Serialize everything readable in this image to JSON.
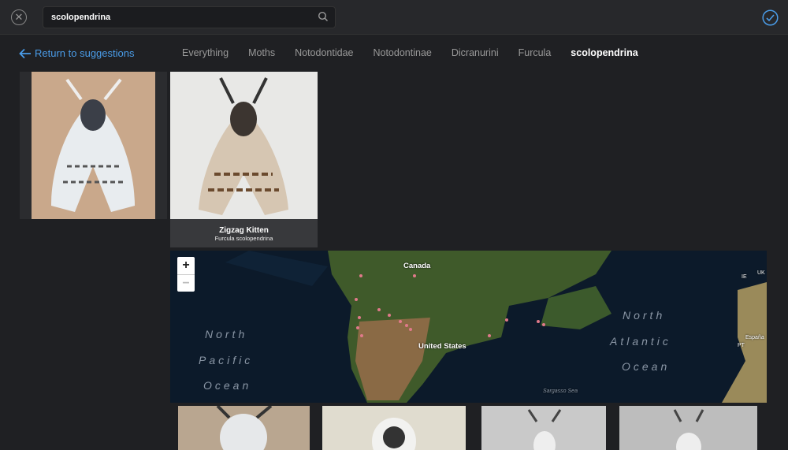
{
  "search": {
    "value": "scolopendrina",
    "icon": "search-icon"
  },
  "nav": {
    "back_label": "Return to suggestions",
    "breadcrumbs": [
      "Everything",
      "Moths",
      "Notodontidae",
      "Notodontinae",
      "Dicranurini",
      "Furcula",
      "scolopendrina"
    ]
  },
  "card": {
    "common_name": "Zigzag Kitten",
    "scientific_name": "Furcula scolopendrina"
  },
  "map": {
    "zoom_in": "+",
    "zoom_out": "−",
    "labels": {
      "canada": "Canada",
      "us": "United States",
      "ie": "IE",
      "uk": "UK",
      "pt": "PT",
      "es": "España",
      "sargasso": "Sargasso Sea"
    },
    "oceans": {
      "pacific": [
        "North",
        "Pacific",
        "Ocean"
      ],
      "atlantic": [
        "North",
        "Atlantic",
        "Ocean"
      ]
    },
    "marker_color": "#e07a8a"
  },
  "colors": {
    "accent": "#4a9ce8"
  }
}
